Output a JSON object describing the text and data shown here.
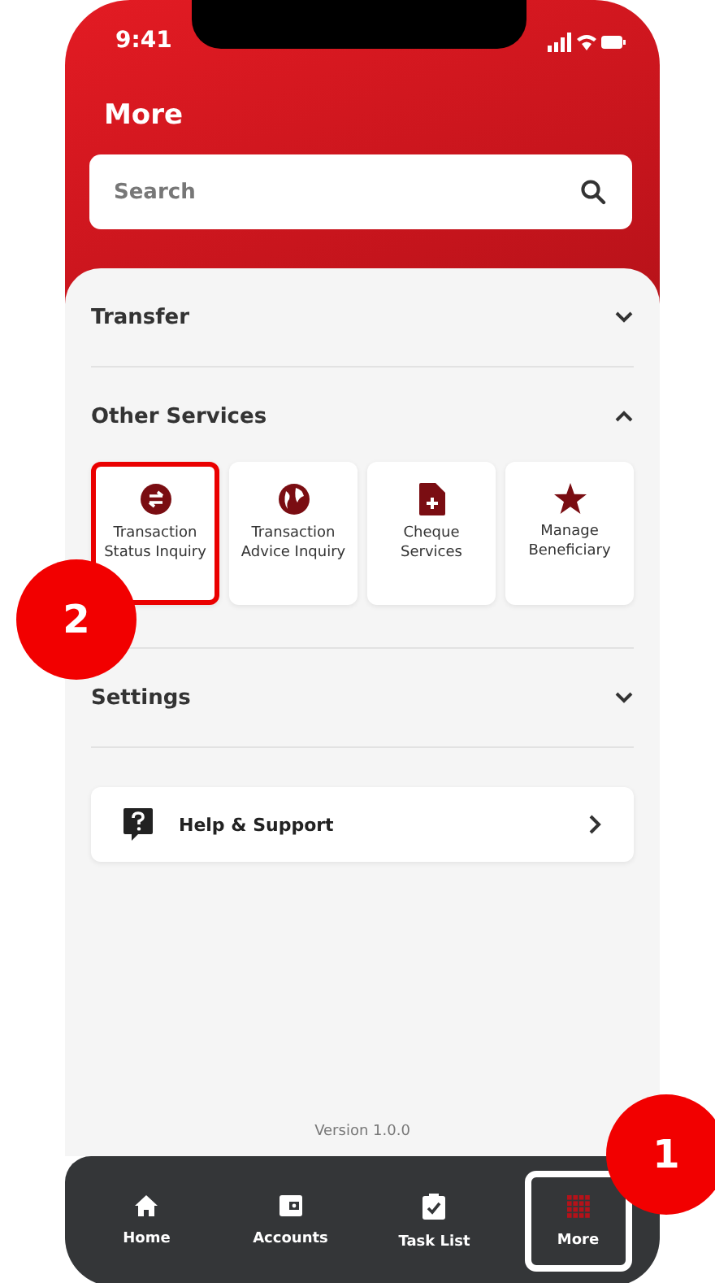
{
  "status_bar": {
    "time": "9:41"
  },
  "header": {
    "title": "More"
  },
  "search": {
    "placeholder": "Search"
  },
  "sections": [
    {
      "title": "Transfer",
      "expanded": false
    },
    {
      "title": "Other Services",
      "expanded": true,
      "tiles": [
        {
          "label": "Transaction Status Inquiry",
          "highlighted": true
        },
        {
          "label": "Transaction Advice Inquiry",
          "highlighted": false
        },
        {
          "label": "Cheque Services",
          "highlighted": false
        },
        {
          "label": "Manage Beneficiary",
          "highlighted": false
        }
      ]
    },
    {
      "title": "Settings",
      "expanded": false
    }
  ],
  "help": {
    "label": "Help & Support"
  },
  "version": "Version 1.0.0",
  "nav": [
    {
      "label": "Home",
      "selected": false,
      "highlighted": false
    },
    {
      "label": "Accounts",
      "selected": false,
      "highlighted": false
    },
    {
      "label": "Task List",
      "selected": false,
      "highlighted": false
    },
    {
      "label": "More",
      "selected": true,
      "highlighted": true
    }
  ],
  "annotations": [
    "1",
    "2"
  ]
}
